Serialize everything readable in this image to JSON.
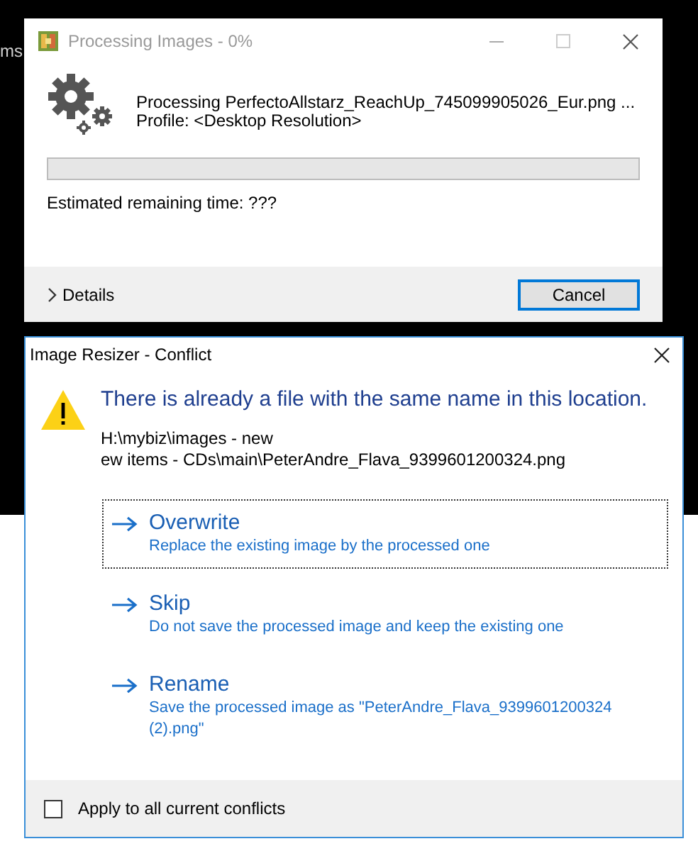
{
  "background": {
    "text": "ms"
  },
  "progress_window": {
    "title": "Processing Images - 0%",
    "message": "Processing PerfectoAllstarz_ReachUp_745099905026_Eur.png ...",
    "profile": "Profile: <Desktop Resolution>",
    "progress": {
      "level": 0
    },
    "estimate": "Estimated remaining time: ???",
    "details": {
      "label": "Details",
      "expanded": false
    },
    "cancel_button": "Cancel"
  },
  "conflict_dialog": {
    "title": "Image Resizer - Conflict",
    "heading": "There is already a file with the same name in this location.",
    "path_lines": [
      "H:\\mybiz\\images - new",
      "ew items - CDs\\main\\PeterAndre_Flava_9399601200324.png"
    ],
    "options": [
      {
        "title": "Overwrite",
        "description": "Replace the existing image by the processed one",
        "selected": true
      },
      {
        "title": "Skip",
        "description": "Do not save the processed image and keep the existing one",
        "selected": false
      },
      {
        "title": "Rename",
        "description": "Save the processed image as \"PeterAndre_Flava_9399601200324 (2).png\"",
        "selected": false
      }
    ],
    "apply_all": {
      "label": "Apply to all current conflicts",
      "checked": false
    }
  }
}
